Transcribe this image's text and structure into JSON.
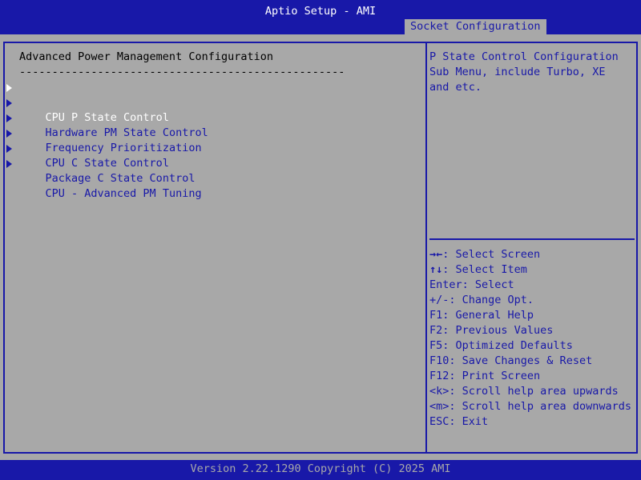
{
  "header": {
    "app_title": "Aptio Setup - AMI",
    "active_tab": "Socket Configuration"
  },
  "main": {
    "section_title": "Advanced Power Management Configuration",
    "separator": "--------------------------------------------------",
    "items": [
      {
        "label": "CPU P State Control",
        "selected": true
      },
      {
        "label": "Hardware PM State Control",
        "selected": false
      },
      {
        "label": "Frequency Prioritization",
        "selected": false
      },
      {
        "label": "CPU C State Control",
        "selected": false
      },
      {
        "label": "Package C State Control",
        "selected": false
      },
      {
        "label": "CPU - Advanced PM Tuning",
        "selected": false
      }
    ]
  },
  "help": {
    "lines": [
      "P State Control Configuration",
      "Sub Menu, include Turbo, XE",
      "and etc."
    ]
  },
  "keys": [
    {
      "key": "→←",
      "desc": ": Select Screen"
    },
    {
      "key": "↑↓",
      "desc": ": Select Item"
    },
    {
      "key": "Enter",
      "desc": ": Select"
    },
    {
      "key": "+/-",
      "desc": ": Change Opt."
    },
    {
      "key": "F1",
      "desc": ": General Help"
    },
    {
      "key": "F2",
      "desc": ": Previous Values"
    },
    {
      "key": "F5",
      "desc": ": Optimized Defaults"
    },
    {
      "key": "F10",
      "desc": ": Save Changes & Reset"
    },
    {
      "key": "F12",
      "desc": ": Print Screen"
    },
    {
      "key": "<k>",
      "desc": ": Scroll help area upwards"
    },
    {
      "key": "<m>",
      "desc": ": Scroll help area downwards"
    },
    {
      "key": "ESC",
      "desc": ": Exit"
    }
  ],
  "footer": {
    "text": "Version 2.22.1290 Copyright (C) 2025 AMI"
  },
  "colors": {
    "background": "#a8a8a8",
    "accent": "#1818a8",
    "selected_text": "#ffffff"
  }
}
